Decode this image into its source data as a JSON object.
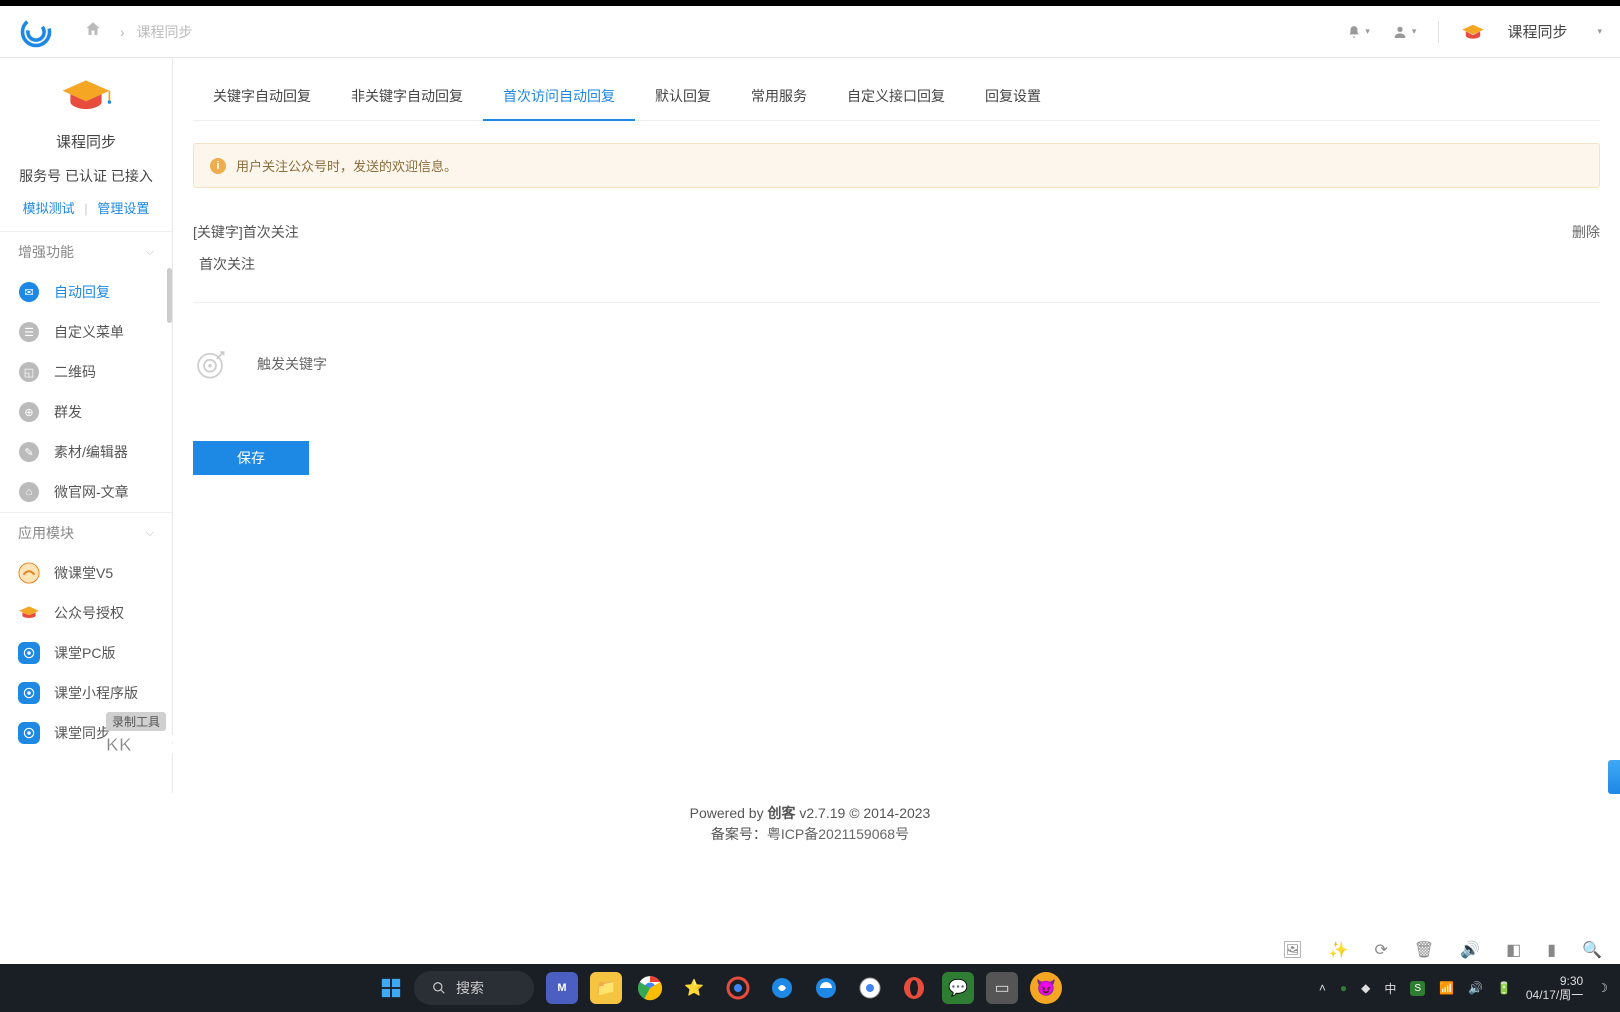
{
  "breadcrumb": {
    "current": "课程同步"
  },
  "header": {
    "app_name": "课程同步"
  },
  "sidebar": {
    "title": "课程同步",
    "subtitle": "服务号 已认证 已接入",
    "link1": "模拟测试",
    "link2": "管理设置",
    "section1": "增强功能",
    "items1": [
      {
        "label": "自动回复",
        "icon": "chat-icon",
        "active": true
      },
      {
        "label": "自定义菜单",
        "icon": "menu-icon"
      },
      {
        "label": "二维码",
        "icon": "qr-icon"
      },
      {
        "label": "群发",
        "icon": "broadcast-icon"
      },
      {
        "label": "素材/编辑器",
        "icon": "material-icon"
      },
      {
        "label": "微官网-文章",
        "icon": "site-icon"
      }
    ],
    "section2": "应用模块",
    "items2": [
      {
        "label": "微课堂V5",
        "icon": "course-icon"
      },
      {
        "label": "公众号授权",
        "icon": "auth-icon"
      },
      {
        "label": "课堂PC版",
        "icon": "pc-icon"
      },
      {
        "label": "课堂小程序版",
        "icon": "mini-icon"
      },
      {
        "label": "课堂同步",
        "icon": "sync-icon"
      }
    ]
  },
  "tabs": [
    "关键字自动回复",
    "非关键字自动回复",
    "首次访问自动回复",
    "默认回复",
    "常用服务",
    "自定义接口回复",
    "回复设置"
  ],
  "active_tab_index": 2,
  "alert": "用户关注公众号时，发送的欢迎信息。",
  "keyword": {
    "title": "[关键字]首次关注",
    "sub": "首次关注",
    "delete": "删除"
  },
  "trigger_label": "触发关键字",
  "save_label": "保存",
  "footer": {
    "line1_prefix": "Powered by ",
    "brand": "创客",
    "version": " v2.7.19 © 2014-2023",
    "line2_prefix": "备案号：",
    "icp": "粤ICP备2021159068号"
  },
  "watermark": {
    "line1": "录制工具",
    "line2": "KK录像机"
  },
  "taskbar": {
    "search": "搜索",
    "ime": "中",
    "time": "9:30",
    "date": "04/17/周一"
  },
  "tray_icons": [
    "image-icon",
    "sparkle-icon",
    "refresh-icon",
    "trash-icon",
    "volume-icon",
    "panel-icon",
    "bar-icon",
    "search-icon"
  ]
}
